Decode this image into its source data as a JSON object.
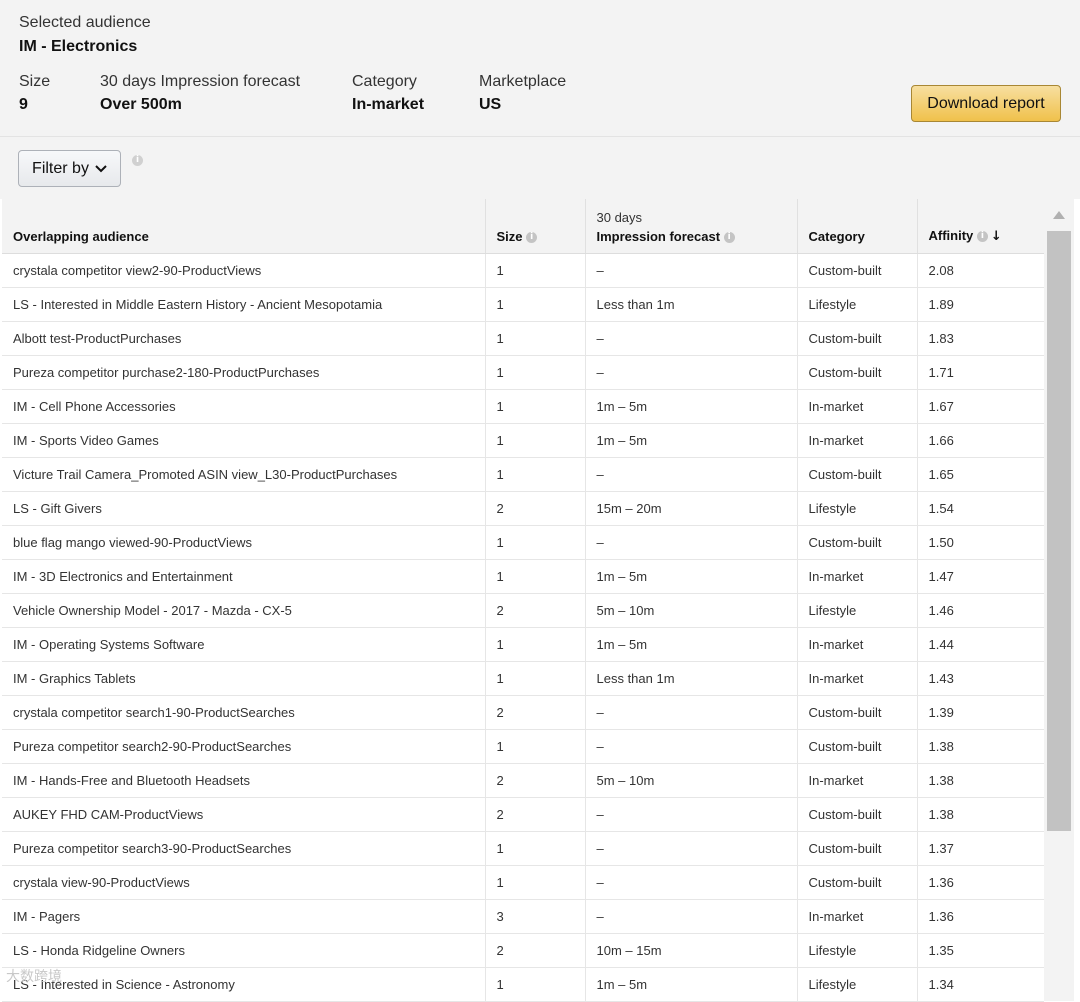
{
  "header": {
    "selected_label": "Selected audience",
    "selected_name": "IM - Electronics",
    "stats": [
      {
        "label": "Size",
        "value": "9"
      },
      {
        "label": "30 days Impression forecast",
        "value": "Over 500m"
      },
      {
        "label": "Category",
        "value": "In-market"
      },
      {
        "label": "Marketplace",
        "value": "US"
      }
    ],
    "download_label": "Download report"
  },
  "filter": {
    "label": "Filter by",
    "info_icon": "info-icon"
  },
  "table": {
    "headers": {
      "audience": "Overlapping audience",
      "size": "Size",
      "forecast_top": "30 days",
      "forecast": "Impression forecast",
      "category": "Category",
      "affinity": "Affinity"
    },
    "sort": {
      "column": "affinity",
      "direction": "descending",
      "icon": "arrow-down-icon"
    },
    "rows": [
      [
        "crystala competitor view2-90-ProductViews",
        "1",
        "–",
        "Custom-built",
        "2.08"
      ],
      [
        "LS - Interested in Middle Eastern History - Ancient Mesopotamia",
        "1",
        "Less than 1m",
        "Lifestyle",
        "1.89"
      ],
      [
        "Albott test-ProductPurchases",
        "1",
        "–",
        "Custom-built",
        "1.83"
      ],
      [
        "Pureza competitor purchase2-180-ProductPurchases",
        "1",
        "–",
        "Custom-built",
        "1.71"
      ],
      [
        "IM - Cell Phone Accessories",
        "1",
        "1m – 5m",
        "In-market",
        "1.67"
      ],
      [
        "IM - Sports Video Games",
        "1",
        "1m – 5m",
        "In-market",
        "1.66"
      ],
      [
        "Victure Trail Camera_Promoted ASIN view_L30-ProductPurchases",
        "1",
        "–",
        "Custom-built",
        "1.65"
      ],
      [
        "LS - Gift Givers",
        "2",
        "15m – 20m",
        "Lifestyle",
        "1.54"
      ],
      [
        "blue flag mango viewed-90-ProductViews",
        "1",
        "–",
        "Custom-built",
        "1.50"
      ],
      [
        "IM - 3D Electronics and Entertainment",
        "1",
        "1m – 5m",
        "In-market",
        "1.47"
      ],
      [
        "Vehicle Ownership Model - 2017 - Mazda - CX-5",
        "2",
        "5m – 10m",
        "Lifestyle",
        "1.46"
      ],
      [
        "IM - Operating Systems Software",
        "1",
        "1m – 5m",
        "In-market",
        "1.44"
      ],
      [
        "IM - Graphics Tablets",
        "1",
        "Less than 1m",
        "In-market",
        "1.43"
      ],
      [
        "crystala competitor search1-90-ProductSearches",
        "2",
        "–",
        "Custom-built",
        "1.39"
      ],
      [
        "Pureza competitor search2-90-ProductSearches",
        "1",
        "–",
        "Custom-built",
        "1.38"
      ],
      [
        "IM - Hands-Free and Bluetooth Headsets",
        "2",
        "5m – 10m",
        "In-market",
        "1.38"
      ],
      [
        "AUKEY FHD CAM-ProductViews",
        "2",
        "–",
        "Custom-built",
        "1.38"
      ],
      [
        "Pureza competitor search3-90-ProductSearches",
        "1",
        "–",
        "Custom-built",
        "1.37"
      ],
      [
        "crystala view-90-ProductViews",
        "1",
        "–",
        "Custom-built",
        "1.36"
      ],
      [
        "IM - Pagers",
        "3",
        "–",
        "In-market",
        "1.36"
      ],
      [
        "LS - Honda Ridgeline Owners",
        "2",
        "10m – 15m",
        "Lifestyle",
        "1.35"
      ],
      [
        "LS - Interested in Science - Astronomy",
        "1",
        "1m – 5m",
        "Lifestyle",
        "1.34"
      ]
    ]
  },
  "watermark": "大数跨境",
  "colors": {
    "panel_bg": "#f3f3f3",
    "download_button": "#f0c14b",
    "scroll_thumb": "#c2c2c2"
  }
}
